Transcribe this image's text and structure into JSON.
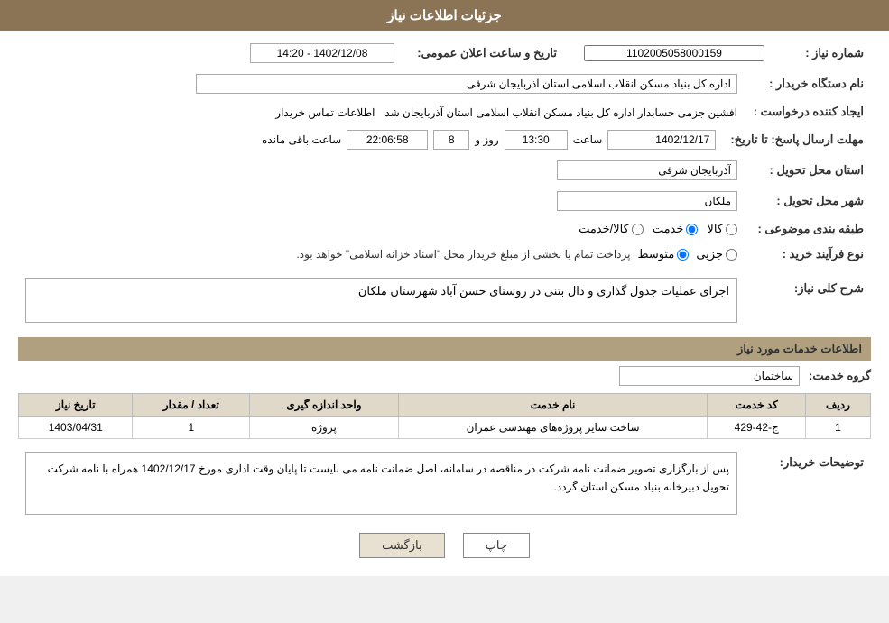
{
  "header": {
    "title": "جزئیات اطلاعات نیاز"
  },
  "fields": {
    "shomareNiaz_label": "شماره نیاز :",
    "shomareNiaz_value": "1102005058000159",
    "namDasgah_label": "نام دستگاه خریدار :",
    "namDasgah_value": "اداره کل بنیاد مسکن انقلاب اسلامی استان آذربایجان شرقی",
    "ijadKonande_label": "ایجاد کننده درخواست :",
    "ijadKonande_value": "افشین جزمی حسابدار اداره کل بنیاد مسکن انقلاب اسلامی استان آذربایجان شد",
    "ijadKonande_link": "اطلاعات تماس خریدار",
    "mohlat_label": "مهلت ارسال پاسخ: تا تاریخ:",
    "date_value": "1402/12/17",
    "time_label": "ساعت",
    "time_value": "13:30",
    "days_label": "روز و",
    "days_value": "8",
    "remain_value": "22:06:58",
    "remain_label": "ساعت باقی مانده",
    "ostan_label": "استان محل تحویل :",
    "ostan_value": "آذربایجان شرقی",
    "shahr_label": "شهر محل تحویل :",
    "shahr_value": "ملکان",
    "tabaghe_label": "طبقه بندی موضوعی :",
    "tabaghe_radio": [
      "کالا",
      "خدمت",
      "کالا/خدمت"
    ],
    "tabaghe_selected": "خدمت",
    "noeFarayand_label": "نوع فرآیند خرید :",
    "noeFarayand_radios": [
      "جزیی",
      "متوسط"
    ],
    "noeFarayand_text": "پرداخت تمام یا بخشی از مبلغ خریدار محل \"اسناد خزانه اسلامی\" خواهد بود.",
    "sharh_label": "شرح کلی نیاز:",
    "sharh_value": "اجرای عملیات جدول گذاری و دال بتنی در روستای حسن آباد شهرستان ملکان",
    "info_khadamat_label": "اطلاعات خدمات مورد نیاز",
    "gorohe_label": "گروه خدمت:",
    "gorohe_value": "ساختمان",
    "table": {
      "headers": [
        "ردیف",
        "کد خدمت",
        "نام خدمت",
        "واحد اندازه گیری",
        "تعداد / مقدار",
        "تاریخ نیاز"
      ],
      "rows": [
        {
          "radif": "1",
          "kod": "ج-42-429",
          "name": "ساخت سایر پروژه‌های مهندسی عمران",
          "vahed": "پروژه",
          "tedad": "1",
          "tarikh": "1403/04/31"
        }
      ]
    },
    "tavzihat_label": "توضیحات خریدار:",
    "tavzihat_value": "پس از بارگزاری تصویر ضمانت نامه شرکت در مناقصه در سامانه، اصل ضمانت نامه می بایست تا پایان وقت اداری مورخ 1402/12/17 همراه با نامه شرکت تحویل دبیرخانه بنیاد مسکن استان گردد.",
    "tarikh_saet_label": "تاریخ و ساعت اعلان عمومی:",
    "tarikh_saet_value": "1402/12/08 - 14:20",
    "buttons": {
      "back": "بازگشت",
      "print": "چاپ"
    }
  }
}
